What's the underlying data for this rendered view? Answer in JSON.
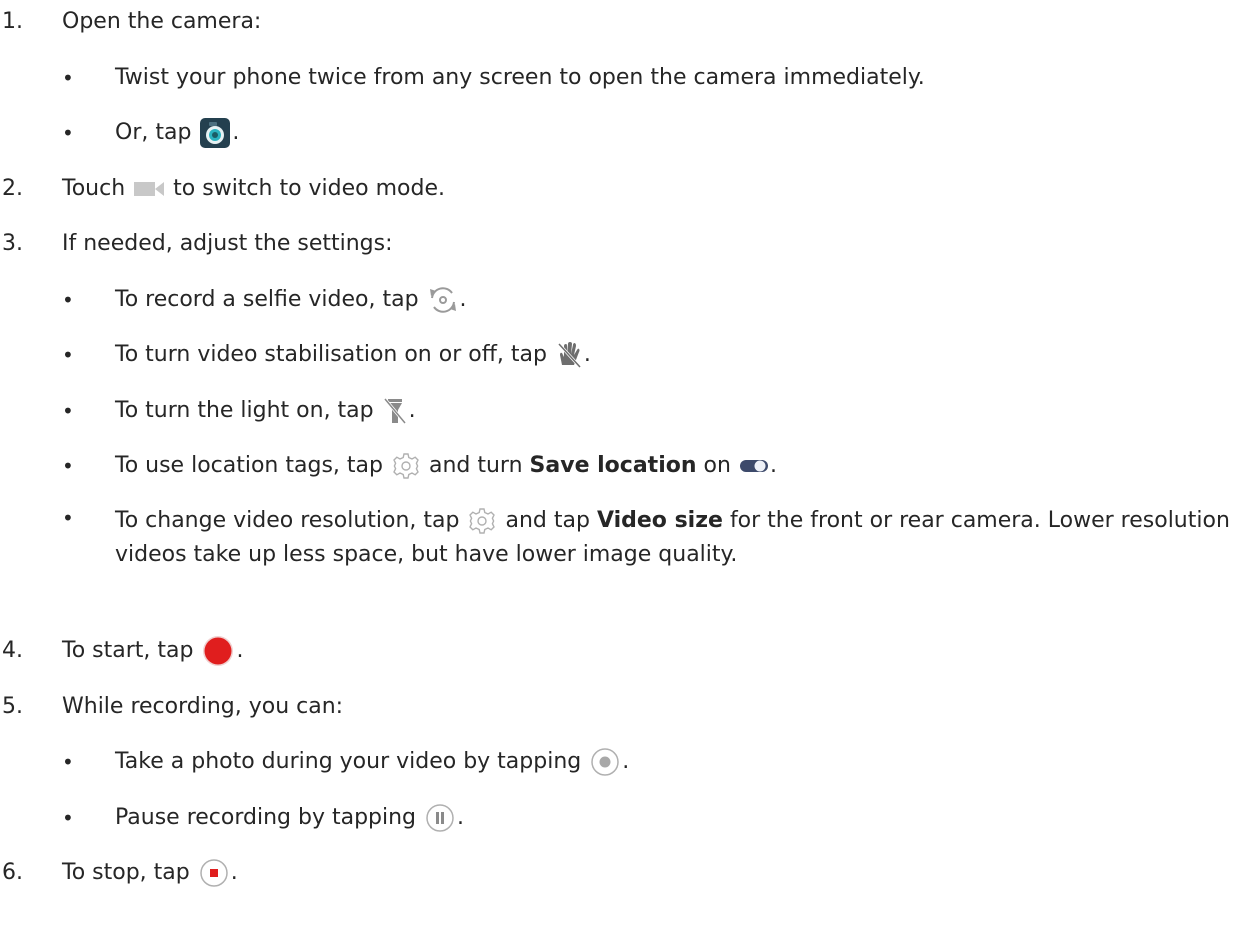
{
  "steps": [
    {
      "num": "1.",
      "text": "Open the camera:"
    },
    {
      "num": "2.",
      "pre": "Touch",
      "post": "to switch to video mode."
    },
    {
      "num": "3.",
      "text": "If needed, adjust the settings:"
    },
    {
      "num": "4.",
      "pre": "To start, tap",
      "post": "."
    },
    {
      "num": "5.",
      "text": "While recording, you can:"
    },
    {
      "num": "6.",
      "pre": "To stop, tap",
      "post": "."
    }
  ],
  "step1_bullets": [
    {
      "text": "Twist your phone twice from any screen to open the camera immediately."
    },
    {
      "pre": "Or, tap",
      "post": "."
    }
  ],
  "step3_bullets": [
    {
      "pre": "To record a selfie video, tap",
      "post": "."
    },
    {
      "pre": "To turn video stabilisation on or off, tap",
      "post": "."
    },
    {
      "pre": "To turn the light on, tap",
      "post": "."
    },
    {
      "pre": "To use location tags, tap",
      "mid": "and turn",
      "bold": "Save location",
      "mid2": "on",
      "post": "."
    },
    {
      "pre": "To change video resolution, tap",
      "mid": "and tap",
      "bold": "Video size",
      "post": "for the front or rear camera. Lower resolution videos take up less space, but have lower image quality."
    }
  ],
  "step5_bullets": [
    {
      "pre": "Take a photo during your video by tapping",
      "post": "."
    },
    {
      "pre": "Pause recording by tapping",
      "post": "."
    }
  ],
  "bullet_char": "•",
  "icons": {
    "camera": "camera-app-icon",
    "video": "video-mode-icon",
    "switch": "switch-camera-icon",
    "stabilise": "stabilisation-icon",
    "light": "flashlight-icon",
    "settings": "settings-gear-icon",
    "toggle": "toggle-switch-icon",
    "record": "record-button-icon",
    "capture": "capture-photo-icon",
    "pause": "pause-icon",
    "stop": "stop-icon"
  },
  "colors": {
    "text": "#262626",
    "record_red": "#e01e1e",
    "camera_bg": "#24404f",
    "camera_teal": "#2bb3c0",
    "icon_grey": "#8a8a8a"
  }
}
